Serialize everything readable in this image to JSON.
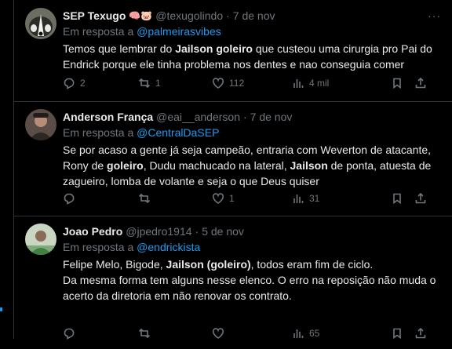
{
  "tweets": [
    {
      "name": "SEP Texugo",
      "emojis": "🧠🐷",
      "handle": "@texugolindo",
      "date": "7 de nov",
      "reply_prefix": "Em resposta a",
      "reply_to": "@palmeirasvibes",
      "body_runs": [
        {
          "t": "Temos que lembrar do "
        },
        {
          "t": "Jailson goleiro",
          "b": true
        },
        {
          "t": " que custeou uma cirurgia pro Pai do Endrick porque ele tinha problema nos dentes e nao conseguia comer"
        }
      ],
      "counts": {
        "replies": "2",
        "retweets": "1",
        "likes": "112",
        "views": "4 mil"
      }
    },
    {
      "name": "Anderson França",
      "handle": "@eai__anderson",
      "date": "7 de nov",
      "reply_prefix": "Em resposta a",
      "reply_to": "@CentralDaSEP",
      "body_runs": [
        {
          "t": "Se por acaso a gente já seja campeão, entraria com Weverton de atacante, Rony de "
        },
        {
          "t": "goleiro",
          "b": true
        },
        {
          "t": ", Dudu machucado na lateral, "
        },
        {
          "t": "Jailson",
          "b": true
        },
        {
          "t": " de ponta, atuesta de zagueiro, lomba de volante e seja o que Deus quiser"
        }
      ],
      "counts": {
        "replies": "",
        "retweets": "",
        "likes": "1",
        "views": "31"
      }
    },
    {
      "name": "Joao Pedro",
      "handle": "@jpedro1914",
      "date": "5 de nov",
      "reply_prefix": "Em resposta a",
      "reply_to": "@endrickista",
      "body_runs": [
        {
          "t": "Felipe Melo, Bigode, "
        },
        {
          "t": "Jailson (goleiro)",
          "b": true
        },
        {
          "t": ", todos eram fim de ciclo."
        }
      ],
      "body_para2": "Da mesma forma tem alguns nesse elenco. O erro na reposição não muda o acerto da diretoria em não renovar os contrato.",
      "counts": {
        "replies": "",
        "retweets": "",
        "likes": "",
        "views": "65"
      }
    }
  ],
  "colors": {
    "accent": "#1d9bf0",
    "muted": "#71767b",
    "text": "#e7e9ea",
    "divider": "#2f3336"
  }
}
